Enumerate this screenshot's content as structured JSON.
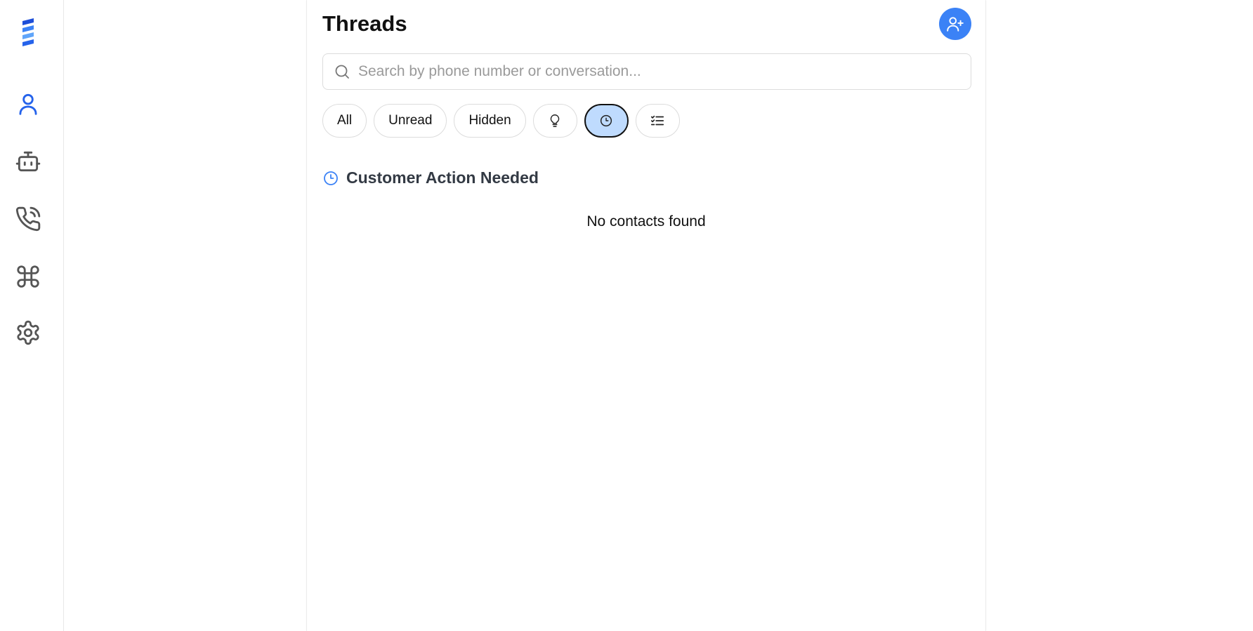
{
  "colors": {
    "accent": "#3b82f6",
    "active_chip_bg": "#bfdbfe",
    "rail_icon": "#555555"
  },
  "rail": {
    "items": [
      {
        "icon": "logo-icon",
        "active": false
      },
      {
        "icon": "user-icon",
        "active": true
      },
      {
        "icon": "bot-icon",
        "active": false
      },
      {
        "icon": "phone-call-icon",
        "active": false
      },
      {
        "icon": "command-icon",
        "active": false
      },
      {
        "icon": "settings-icon",
        "active": false
      }
    ]
  },
  "header": {
    "title": "Threads",
    "add_contact_icon": "user-plus-icon"
  },
  "search": {
    "placeholder": "Search by phone number or conversation...",
    "value": ""
  },
  "filters": {
    "all_label": "All",
    "unread_label": "Unread",
    "hidden_label": "Hidden",
    "icon_filters": [
      "lightbulb-icon",
      "clock-icon",
      "list-checks-icon"
    ],
    "active": "clock-icon"
  },
  "section": {
    "title": "Customer Action Needed",
    "icon": "clock-icon"
  },
  "empty_state": {
    "message": "No contacts found"
  }
}
